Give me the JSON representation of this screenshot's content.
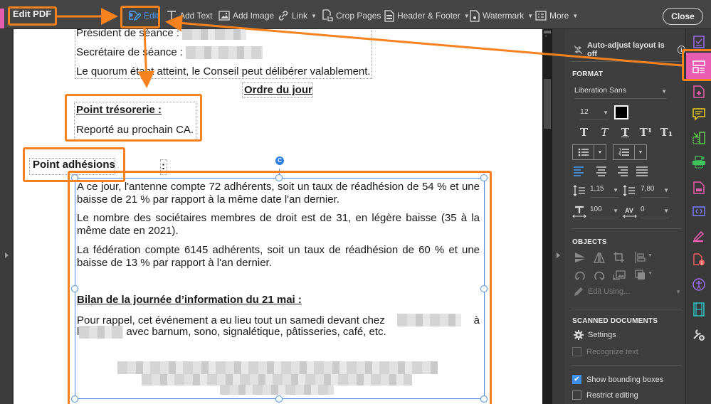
{
  "toolbar": {
    "title": "Edit PDF",
    "items": [
      {
        "label": "Edit",
        "icon": "edit-icon",
        "active": true
      },
      {
        "label": "Add Text",
        "icon": "add-text-icon"
      },
      {
        "label": "Add Image",
        "icon": "add-image-icon"
      },
      {
        "label": "Link",
        "icon": "link-icon",
        "dropdown": true
      },
      {
        "label": "Crop Pages",
        "icon": "crop-pages-icon"
      },
      {
        "label": "Header & Footer",
        "icon": "header-footer-icon",
        "dropdown": true
      },
      {
        "label": "Watermark",
        "icon": "watermark-icon",
        "dropdown": true
      },
      {
        "label": "More",
        "icon": "more-icon",
        "dropdown": true
      }
    ],
    "close_label": "Close",
    "caret": "▼"
  },
  "document": {
    "president_label": "Président de séance :",
    "secretary_label": "Secrétaire de séance :",
    "quorum": "Le quorum étant atteint, le Conseil peut délibérer valablement.",
    "ordre_du_jour": "Ordre du jour",
    "tresorerie_heading": "Point trésorerie :",
    "tresorerie_text": "Reporté au prochain CA.",
    "adhesions_heading": "Point adhésions",
    "adhesions_colon": ":",
    "para1": "A ce jour, l'antenne compte 72 adhérents, soit un taux de réadhésion de 54 % et une baisse de 21 % par rapport à la même date l'an dernier.",
    "para2": "Le nombre des sociétaires membres de droit est de 31, en légère baisse (35 à la même date en 2021).",
    "para3": "La fédération compte 6145 adhérents, soit un taux de réadhésion de 60 % et une baisse de 13 % par rapport à l'an dernier.",
    "bilan_heading": "Bilan de la journée d’information du 21 mai :",
    "bilan_text_a": "Pour rappel, cet événement a eu lieu tout un samedi devant chez",
    "bilan_text_b": "à",
    "bilan_text_c": "l",
    "bilan_text_d": "avec barnum, sono, signalétique, pâtisseries, café, etc.",
    "rotate_handle": "C"
  },
  "panel": {
    "auto_adjust": "Auto-adjust layout is off",
    "info": "i",
    "format_heading": "FORMAT",
    "font_family": "Liberation Sans",
    "font_size": "12",
    "text_color": "#000000",
    "style_buttons": [
      "T",
      "T",
      "T",
      "T¹",
      "T₁"
    ],
    "line_spacing": "1,15",
    "paragraph_spacing": "7,80",
    "horizontal_scale": "100",
    "char_spacing": "0",
    "objects_heading": "OBJECTS",
    "edit_using": "Edit Using...",
    "scanned_heading": "SCANNED DOCUMENTS",
    "settings": "Settings",
    "recognize_text": "Recognize text",
    "show_bounding_boxes": "Show bounding boxes",
    "show_bounding_boxes_checked": true,
    "restrict_editing": "Restrict editing",
    "restrict_editing_checked": false,
    "caret": "▼"
  },
  "rail": {
    "items": [
      {
        "name": "fill-sign-icon",
        "color": "#9b6cf0"
      },
      {
        "name": "edit-pdf-icon",
        "color": "#ffffff",
        "active": true
      },
      {
        "name": "create-pdf-icon",
        "color": "#e85db0"
      },
      {
        "name": "comment-icon",
        "color": "#f0d020"
      },
      {
        "name": "combine-files-icon",
        "color": "#5ed04a"
      },
      {
        "name": "print-production-icon",
        "color": "#3ec45a"
      },
      {
        "name": "export-pdf-icon",
        "color": "#e85db0"
      },
      {
        "name": "javascript-icon",
        "color": "#7d7dff"
      },
      {
        "name": "request-signature-icon",
        "color": "#e85db0"
      },
      {
        "name": "pdf-standards-icon",
        "color": "#f06060"
      },
      {
        "name": "accessibility-icon",
        "color": "#9b6cf0"
      },
      {
        "name": "rich-media-icon",
        "color": "#2ec4c4"
      },
      {
        "name": "more-tools-icon",
        "color": "#d0d0d0"
      }
    ]
  },
  "colors": {
    "accent_blue": "#4a9ff5",
    "annotation_orange": "#f5821f",
    "active_pink": "#e85db0"
  }
}
